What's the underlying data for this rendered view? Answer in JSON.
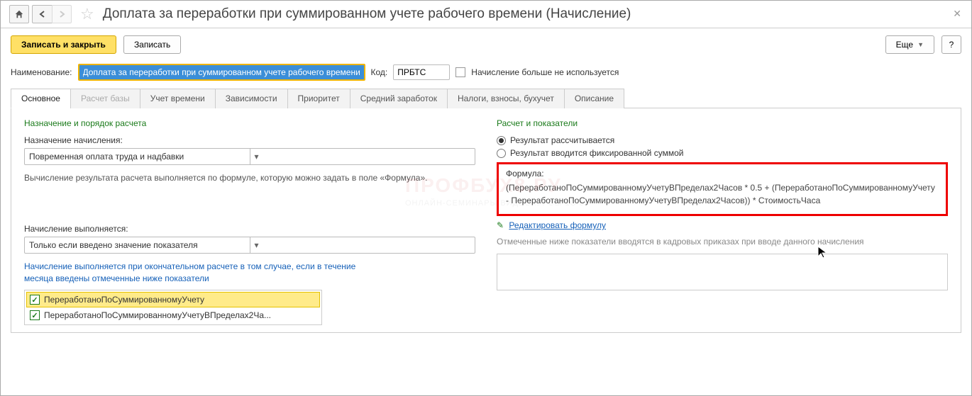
{
  "title": "Доплата за переработки при суммированном учете рабочего времени (Начисление)",
  "toolbar": {
    "save_close": "Записать и закрыть",
    "save": "Записать",
    "more": "Еще",
    "help": "?"
  },
  "form": {
    "name_label": "Наименование:",
    "name_value": "Доплата за переработки при суммированном учете рабочего времени",
    "code_label": "Код:",
    "code_value": "ПРБТС",
    "not_used_label": "Начисление больше не используется"
  },
  "tabs": [
    "Основное",
    "Расчет базы",
    "Учет времени",
    "Зависимости",
    "Приоритет",
    "Средний заработок",
    "Налоги, взносы, бухучет",
    "Описание"
  ],
  "left": {
    "section": "Назначение и порядок расчета",
    "purpose_label": "Назначение начисления:",
    "purpose_value": "Повременная оплата труда и надбавки",
    "calc_note": "Вычисление результата расчета выполняется по формуле, которую можно задать в поле «Формула».",
    "exec_label": "Начисление выполняется:",
    "exec_value": "Только если введено значение показателя",
    "blue_note": "Начисление выполняется при окончательном расчете в том случае, если в течение месяца введены отмеченные ниже показатели",
    "indicators": [
      "ПереработаноПоСуммированномуУчету",
      "ПереработаноПоСуммированномуУчетуВПределах2Ча..."
    ]
  },
  "right": {
    "section": "Расчет и показатели",
    "radio1": "Результат рассчитывается",
    "radio2": "Результат вводится фиксированной суммой",
    "formula_label": "Формула:",
    "formula_text": "(ПереработаноПоСуммированномуУчетуВПределах2Часов * 0.5 + (ПереработаноПоСуммированномуУчету - ПереработаноПоСуммированномуУчетуВПределах2Часов)) * СтоимостьЧаса",
    "edit_link": "Редактировать формулу",
    "note": "Отмеченные ниже показатели вводятся в кадровых приказах при вводе данного начисления"
  }
}
